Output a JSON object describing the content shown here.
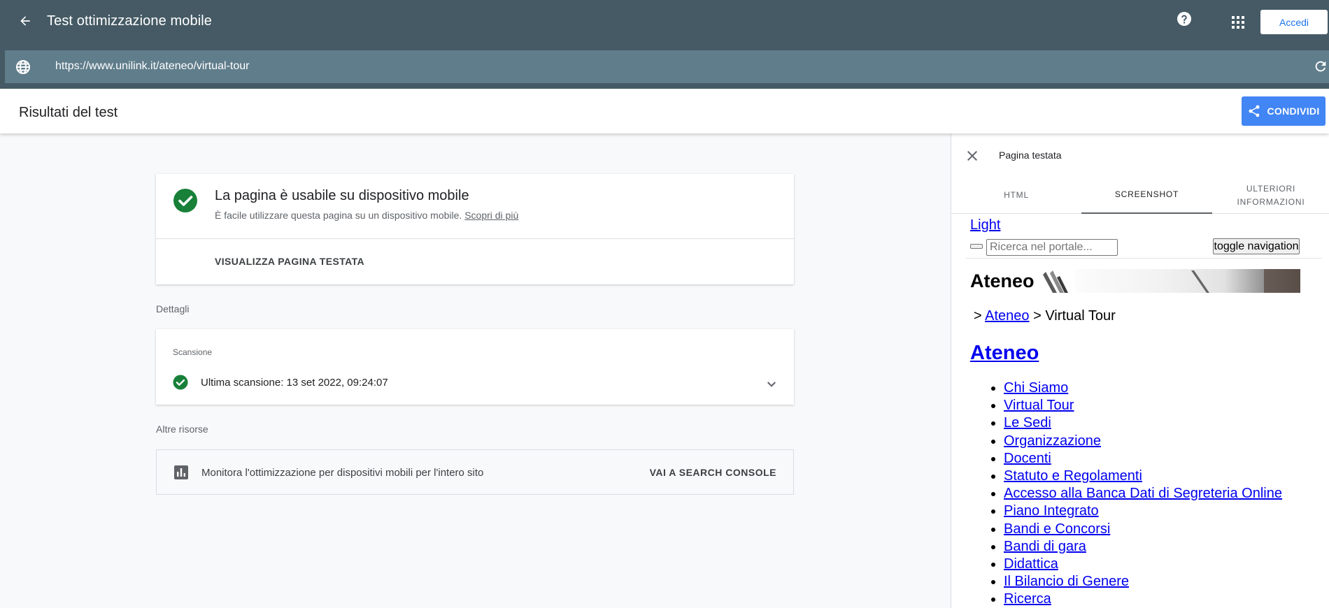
{
  "appbar": {
    "title": "Test ottimizzazione mobile",
    "signin_label": "Accedi",
    "url": "https://www.unilink.it/ateneo/virtual-tour"
  },
  "results": {
    "title": "Risultati del test",
    "share_label": "CONDIVIDI"
  },
  "usable_card": {
    "heading": "La pagina è usabile su dispositivo mobile",
    "description": "È facile utilizzare questa pagina su un dispositivo mobile.",
    "learn_more": "Scopri di più",
    "view_button": "VISUALIZZA PAGINA TESTATA"
  },
  "details": {
    "label": "Dettagli",
    "section_label": "Scansione",
    "last_crawl": "Ultima scansione: 13 set 2022, 09:24:07"
  },
  "resources": {
    "label": "Altre risorse",
    "text": "Monitora l'ottimizzazione per dispositivi mobili per l'intero sito",
    "link": "VAI A SEARCH CONSOLE"
  },
  "panel": {
    "title": "Pagina testata",
    "tabs": [
      "HTML",
      "SCREENSHOT",
      "ULTERIORI INFORMAZIONI"
    ],
    "screenshot": {
      "light_link": "Light",
      "search_placeholder": "Ricerca nel portale...",
      "toggle_label": "toggle navigation",
      "banner_word": "Ateneo",
      "crumb_prefix": ">",
      "crumb_link": "Ateneo",
      "crumb_suffix": "> Virtual Tour",
      "heading": "Ateneo",
      "menu": [
        "Chi Siamo",
        "Virtual Tour",
        "Le Sedi",
        "Organizzazione",
        "Docenti",
        "Statuto e Regolamenti",
        "Accesso alla Banca Dati di Segreteria Online",
        "Piano Integrato",
        "Bandi e Concorsi",
        "Bandi di gara",
        "Didattica",
        "Il Bilancio di Genere",
        "Ricerca"
      ]
    }
  },
  "colors": {
    "appbar": "#455a64",
    "urlbar": "#607d8b",
    "accent": "#4285f4",
    "success": "#188038",
    "link": "#0000ee"
  }
}
